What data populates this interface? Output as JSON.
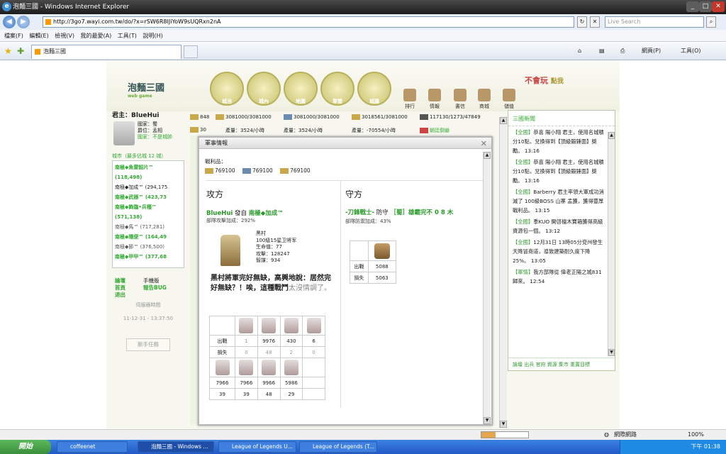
{
  "window": {
    "title": "泡麵三國 - Windows Internet Explorer"
  },
  "browser": {
    "url": "http://3go7.wayi.com.tw/do/?x=rSW6R8IJiYoW9sUQRxn2nA",
    "search_placeholder": "Live Search",
    "menu": [
      "檔案(F)",
      "編輯(E)",
      "檢視(V)",
      "我的最愛(A)",
      "工具(T)",
      "說明(H)"
    ],
    "tab_title": "泡麵三國",
    "toolbar_right": [
      "網頁(P)",
      "工具(O)"
    ]
  },
  "game": {
    "logo": "泡麵三國",
    "logo_sub": "web game",
    "main_nav": [
      "城池",
      "城內",
      "地圖",
      "軍營",
      "城牆"
    ],
    "sub_nav": [
      "排行",
      "情報",
      "書信",
      "商城",
      "儲值"
    ],
    "promo": "不會玩",
    "promo_sub": "點我",
    "player_title": "君主：BlueHui",
    "player_info": [
      "國家：蜀",
      "爵位：孟相",
      "國家：不是城帥"
    ],
    "city_header": "城市（最多佔城 12 城）",
    "cities": [
      "南極◆魚雷韶片™ (118,498)",
      "南極◆加成™ (294,175",
      "南極◆武器™ (423,73",
      "南極◆鉤臨•兵種™ (571,138)",
      "南極◆馬™ (717,281)",
      "南極◆隨便™ (164,49",
      "南極◆節™ (376,500)",
      "南極◆甲甲™ (377,68"
    ],
    "left_links": [
      "論壇",
      "首頁",
      "退出",
      "手機版",
      "報告BUG"
    ],
    "server_time_label": "伺服器時間",
    "server_time": "11-12-31 - 13:37:50",
    "newbie_task": "新手任務",
    "resources": [
      {
        "value": "848"
      },
      {
        "value": "3081000/3081000"
      },
      {
        "value": "3081000/3081000"
      },
      {
        "value": "3018561/3081000"
      },
      {
        "value": "117130/1273/47849"
      }
    ],
    "production": [
      {
        "value": "30"
      },
      {
        "value": "產量：3524/小時"
      },
      {
        "value": "產量：3524/小時"
      },
      {
        "value": "產量：-70554/小時"
      },
      {
        "value": "朝廷倒爺"
      }
    ]
  },
  "news": {
    "title": "三國新聞",
    "items": [
      {
        "tag": "【全國】",
        "text": "恭喜 陽小翔 君主，使用名城積分10點，兌換得到【頂級鍛錘面】獎勵。 13:16"
      },
      {
        "tag": "【全國】",
        "text": "恭喜 陽小翔 君主，使用名城積分10點，兌換得到【頂級鍛錘面】獎勵。 13:16"
      },
      {
        "tag": "【全國】",
        "text": "Barberry 君主率領大軍成功消滅了 100級BOSS 山寨 孟獲，獲得豐厚戰利品。 13:15"
      },
      {
        "tag": "【全國】",
        "text": "季KUO 開啓檀木寶箱獲得高級資源包一個。 13:12"
      },
      {
        "tag": "【全國】",
        "text": "12月31日 13時05分兗州發生天降冒商道，導致建築耐久度下降 25%。 13:05"
      },
      {
        "tag": "【軍情】",
        "text": "我方部隊從 偉老正陽之城831 歸來。 12:54"
      }
    ],
    "footer": "論壇 出兵 官府 資源 集市 重置目標"
  },
  "dialog": {
    "title": "軍事情報",
    "spoils_label": "戰利品：",
    "spoils": [
      "769100",
      "769100",
      "769100"
    ],
    "attacker": {
      "heading": "攻方",
      "name": "BlueHui",
      "from": "發自",
      "city": "南極◆加成™",
      "bonus": "部隊攻擊加成：292%",
      "general_name": "黑村",
      "general_rank": "100級15星卫将军",
      "hp": "生命值：77",
      "attack": "攻擊：128247",
      "intel": "智謀：934",
      "quote": "黑村將軍完好無缺，高興地說：居然完好無缺？！唉，這種戰鬥",
      "quote_tail": "太沒情調了。",
      "row_labels": [
        "出戰",
        "損失"
      ],
      "units_row1": {
        "sent": [
          "1",
          "9976",
          "430",
          "6"
        ],
        "lost": [
          "0",
          "48",
          "2",
          "0"
        ]
      },
      "units_row2": {
        "sent": [
          "7966",
          "7966",
          "9966",
          "5986"
        ],
        "lost": [
          "39",
          "39",
          "48",
          "29"
        ]
      }
    },
    "defender": {
      "heading": "守方",
      "name": "-刀鋒戰士-",
      "defends": "防守",
      "city": "［蜀］雄霸完不 0 8 木",
      "bonus": "部隊防禦加成：43%",
      "row_labels": [
        "出戰",
        "損失"
      ],
      "sent": "5088",
      "lost": "5063"
    }
  },
  "status": {
    "zone": "網際網路",
    "zoom": "100%"
  },
  "taskbar": {
    "start": "開始",
    "tasks": [
      "coffeenet",
      "泡麵三國 - Windows ...",
      "League of Legends U...",
      "League of Legends (T..."
    ],
    "clock": "下午 01:38"
  }
}
